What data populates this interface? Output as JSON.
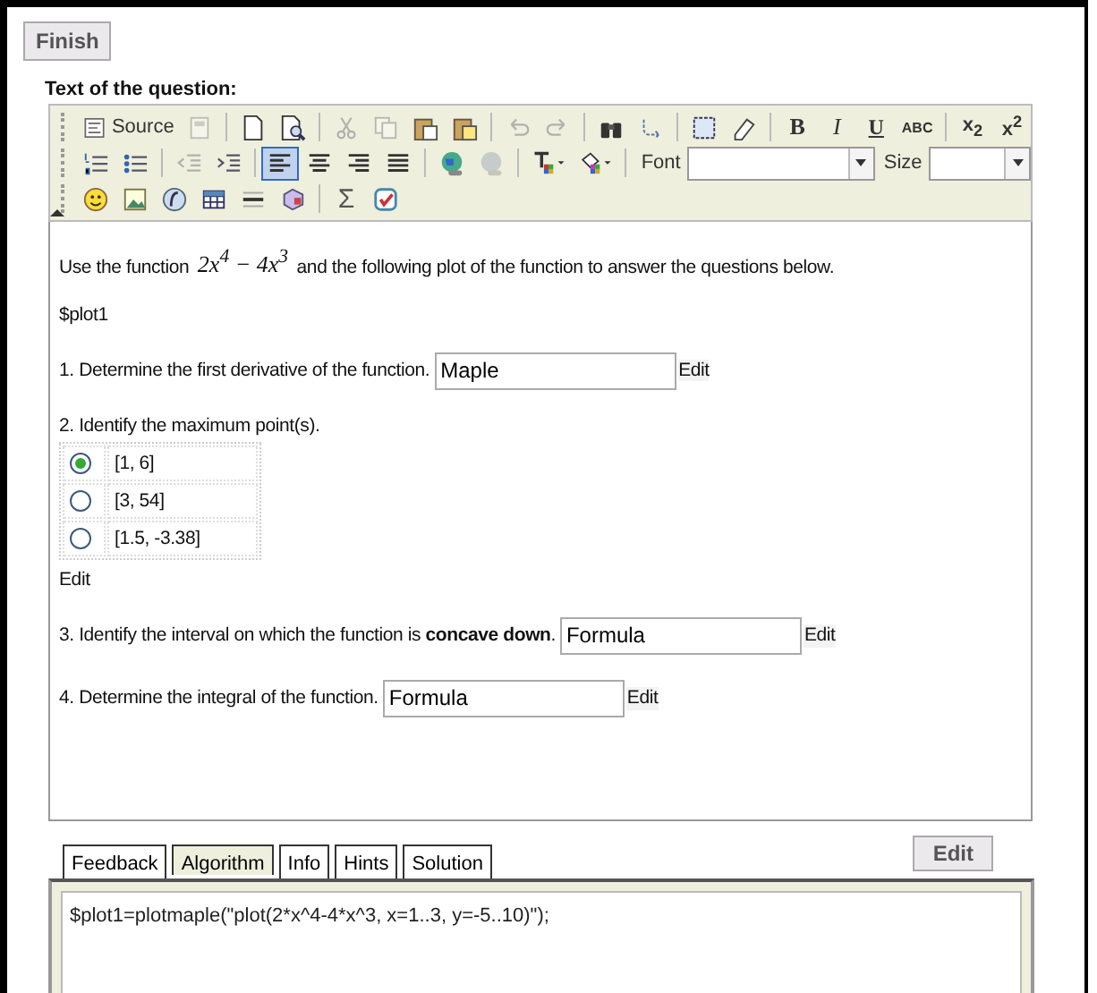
{
  "finish_button": "Finish",
  "question_label": "Text of the question:",
  "toolbar": {
    "rows": [
      [
        {
          "kind": "source",
          "label": "Source"
        },
        {
          "kind": "icon",
          "disabled": true
        },
        {
          "kind": "separator"
        },
        {
          "kind": "icon",
          "disabled": false
        },
        {
          "kind": "icon",
          "disabled": false
        },
        {
          "kind": "separator"
        },
        {
          "kind": "icon",
          "disabled": true
        },
        {
          "kind": "icon",
          "disabled": true
        },
        {
          "kind": "icon",
          "disabled": false
        },
        {
          "kind": "icon",
          "disabled": false
        },
        {
          "kind": "separator"
        },
        {
          "kind": "icon",
          "disabled": true
        },
        {
          "kind": "icon",
          "disabled": true
        },
        {
          "kind": "separator"
        },
        {
          "kind": "icon",
          "disabled": false
        },
        {
          "kind": "icon",
          "disabled": false
        },
        {
          "kind": "separator"
        },
        {
          "kind": "icon",
          "disabled": false
        },
        {
          "kind": "icon",
          "disabled": false
        },
        {
          "kind": "separator"
        },
        {
          "kind": "bold",
          "label": "B"
        },
        {
          "kind": "italic",
          "label": "I"
        },
        {
          "kind": "underline",
          "label": "U"
        },
        {
          "kind": "strike",
          "label": "ABC"
        },
        {
          "kind": "separator"
        },
        {
          "kind": "script",
          "label": "x$_{2}$"
        },
        {
          "kind": "script",
          "label": "x$^{2}$"
        }
      ],
      [
        {
          "kind": "icon",
          "disabled": false
        },
        {
          "kind": "icon",
          "disabled": false
        },
        {
          "kind": "separator"
        },
        {
          "kind": "icon",
          "disabled": true
        },
        {
          "kind": "icon",
          "disabled": false
        },
        {
          "kind": "separator"
        },
        {
          "kind": "icon",
          "disabled": false,
          "active": true
        },
        {
          "kind": "icon",
          "disabled": false,
          "active": false
        },
        {
          "kind": "icon",
          "disabled": false,
          "active": false
        },
        {
          "kind": "icon",
          "disabled": false,
          "active": false
        },
        {
          "kind": "separator"
        },
        {
          "kind": "icon",
          "disabled": false
        },
        {
          "kind": "icon",
          "disabled": true
        },
        {
          "kind": "separator"
        },
        {
          "kind": "dropdown_icon"
        },
        {
          "kind": "dropdown_icon"
        },
        {
          "kind": "separator"
        },
        {
          "kind": "select",
          "label": "Font"
        },
        {
          "kind": "select",
          "label": "Size"
        }
      ],
      [
        {
          "kind": "icon",
          "disabled": false
        },
        {
          "kind": "icon",
          "disabled": false
        },
        {
          "kind": "icon",
          "disabled": false
        },
        {
          "kind": "icon",
          "disabled": false
        },
        {
          "kind": "icon",
          "disabled": false
        },
        {
          "kind": "icon",
          "disabled": false
        },
        {
          "kind": "separator"
        },
        {
          "kind": "glyph",
          "label": "Σ"
        },
        {
          "kind": "icon",
          "disabled": false
        }
      ]
    ]
  },
  "content": [
    {
      "kind": "math_text",
      "before": "Use the function",
      "math": "2x$^{4}$ − 4x$^{3}$",
      "after": "and the following plot of the function to answer the questions below."
    },
    {
      "kind": "text",
      "text": "$plot1"
    },
    {
      "kind": "field",
      "text": "1. Determine the first derivative of the function.",
      "value": "Maple",
      "edit": "Edit"
    },
    {
      "kind": "choice",
      "text": "2. Identify the maximum point(s).",
      "options": [
        {
          "label": "[1, 6]",
          "selected": true
        },
        {
          "label": "[3, 54]",
          "selected": false
        },
        {
          "label": "[1.5, -3.38]",
          "selected": false
        }
      ],
      "edit": "Edit"
    },
    {
      "kind": "field",
      "text": "3. Identify the interval on which the function is **concave down**.",
      "value": "Formula",
      "edit": "Edit"
    },
    {
      "kind": "field",
      "text": "4. Determine the integral of the function.",
      "value": "Formula",
      "edit": "Edit"
    }
  ],
  "tabs": [
    {
      "label": "Feedback",
      "selected": false
    },
    {
      "label": "Algorithm",
      "selected": true
    },
    {
      "label": "Info",
      "selected": false
    },
    {
      "label": "Hints",
      "selected": false
    },
    {
      "label": "Solution",
      "selected": false
    }
  ],
  "edit_button": "Edit",
  "algorithm_code": "$plot1=plotmaple(\"plot(2*x^4-4*x^3, x=1..3, y=-5..10)\");"
}
